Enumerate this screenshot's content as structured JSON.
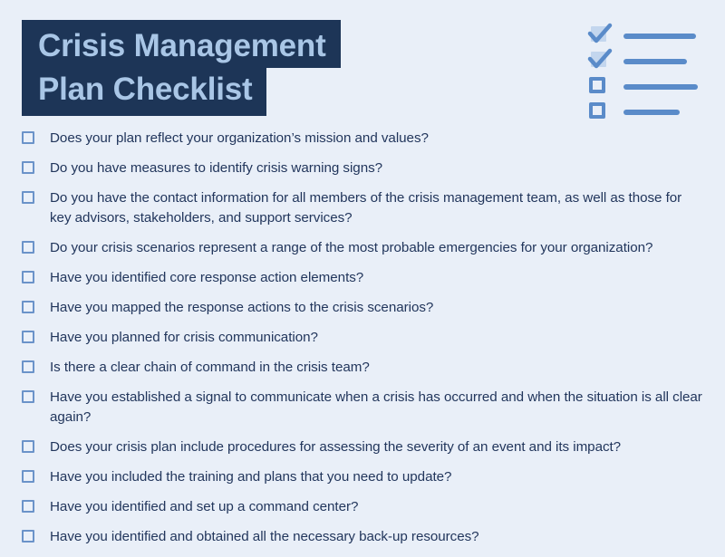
{
  "header": {
    "title_line_1": "Crisis Management",
    "title_line_2": "Plan Checklist",
    "box_color": "#1d3557",
    "text_color": "#a9c6e6"
  },
  "decorative_icon": {
    "name": "checklist-icon",
    "accent_color": "#5a8bc9",
    "fill_color": "#c3d6ee",
    "rows": [
      {
        "state": "checked",
        "line_width": 80
      },
      {
        "state": "checked",
        "line_width": 70
      },
      {
        "state": "unchecked",
        "line_width": 82
      },
      {
        "state": "unchecked",
        "line_width": 62
      }
    ]
  },
  "page": {
    "background_color": "#e9eff8",
    "text_color": "#22365c",
    "checkbox_border_color": "#6b93c9"
  },
  "checklist": {
    "items": [
      {
        "text": "Does your plan reflect your organization’s mission and values?",
        "checked": false
      },
      {
        "text": "Do you have measures to identify crisis warning signs?",
        "checked": false
      },
      {
        "text": "Do you have the contact information for all members of the crisis management team, as well as those for key advisors, stakeholders, and support services?",
        "checked": false
      },
      {
        "text": "Do your crisis scenarios represent a range of the most probable emergencies for your organization?",
        "checked": false
      },
      {
        "text": "Have you identified core response action elements?",
        "checked": false
      },
      {
        "text": "Have you mapped the response actions to the crisis scenarios?",
        "checked": false
      },
      {
        "text": "Have you planned for crisis communication?",
        "checked": false
      },
      {
        "text": "Is there a clear chain of command in the crisis team?",
        "checked": false
      },
      {
        "text": "Have you established a signal to communicate when a crisis has occurred and when the situation is all clear again?",
        "checked": false
      },
      {
        "text": "Does your crisis plan include procedures for assessing the severity of an event and its impact?",
        "checked": false
      },
      {
        "text": "Have you included the training and plans that you need to update?",
        "checked": false
      },
      {
        "text": "Have you identified and set up a command center?",
        "checked": false
      },
      {
        "text": "Have you identified and obtained all the necessary back-up resources?",
        "checked": false
      }
    ]
  }
}
